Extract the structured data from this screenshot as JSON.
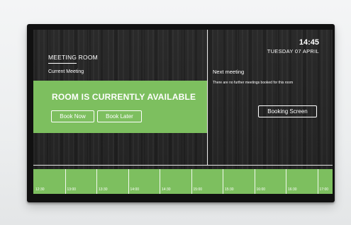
{
  "room": {
    "name": "MEETING ROOM",
    "current_label": "Current Meeting",
    "status": "ROOM IS CURRENTLY AVAILABLE",
    "book_now_label": "Book Now",
    "book_later_label": "Book Later"
  },
  "clock": {
    "time": "14:45",
    "date": "TUESDAY 07 APRIL"
  },
  "next_meeting": {
    "label": "Next meeting",
    "text": "There are no further meetings booked for this room",
    "booking_screen_label": "Booking Screen"
  },
  "timeline": {
    "slots": [
      "12:30",
      "13:00",
      "13:30",
      "14:00",
      "14:30",
      "15:00",
      "15:30",
      "16:00",
      "16:30",
      "17:00"
    ]
  },
  "colors": {
    "available_green": "#7dbf5f",
    "screen_dark": "#262626"
  }
}
